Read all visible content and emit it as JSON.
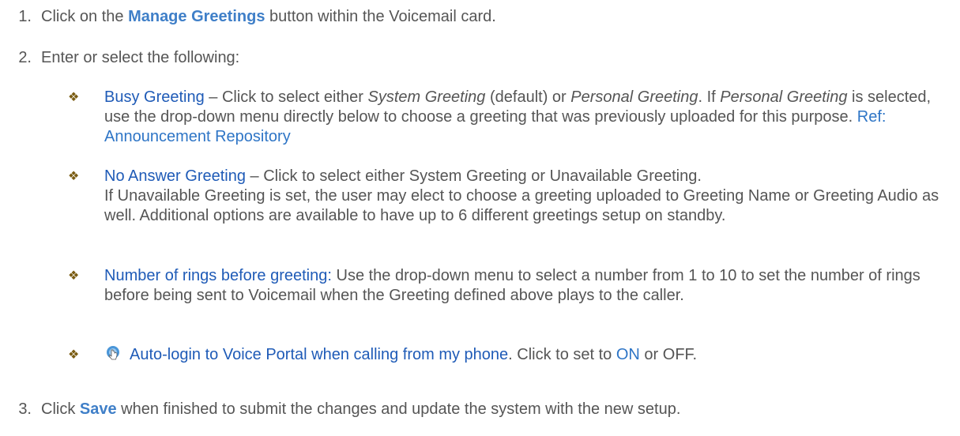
{
  "steps": [
    {
      "number": "1.",
      "before": "Click on the ",
      "bold": "Manage Greetings",
      "after": " button within the Voicemail card."
    },
    {
      "number": "2.",
      "text": "Enter or select the following:"
    },
    {
      "number": "3.",
      "before": "Click ",
      "bold": "Save",
      "after": " when finished to submit the changes and update the system with the new setup."
    }
  ],
  "bullet_symbol": "❖",
  "bullets": {
    "busy": {
      "term": "Busy Greeting",
      "dash": " – Click to select either ",
      "system": "System Greeting",
      "default": " (default) or ",
      "personal": "Personal Greeting",
      "if": ". If ",
      "personal2": "Personal Greeting",
      "rest": " is selected, use the drop-down menu directly below to choose a greeting that was previously uploaded for this purpose. ",
      "ref": "Ref: Announcement Repository"
    },
    "no_answer": {
      "term": "No Answer Greeting",
      "line1": " – Click to select either System Greeting or Unavailable Greeting.",
      "line2": "If Unavailable Greeting is set, the user may elect to choose a greeting uploaded to Greeting Name or Greeting Audio as well. Additional options are available to have up to 6 different greetings setup on standby."
    },
    "rings": {
      "term": "Number of rings before greeting:",
      "text": " Use the drop-down menu to select a number from 1 to 10 to set the number of rings before being sent to Voicemail when the Greeting defined above plays to the caller."
    },
    "autologin": {
      "icon": "pointer-hand-icon",
      "term": "Auto-login to Voice Portal when calling from my phone",
      "text": ". Click to set to ",
      "on": "ON",
      "or": " or OFF."
    }
  },
  "colors": {
    "body_text": "#555555",
    "term": "#1f5bb7",
    "bold_label": "#3f7fc8",
    "link": "#2e75c6"
  }
}
